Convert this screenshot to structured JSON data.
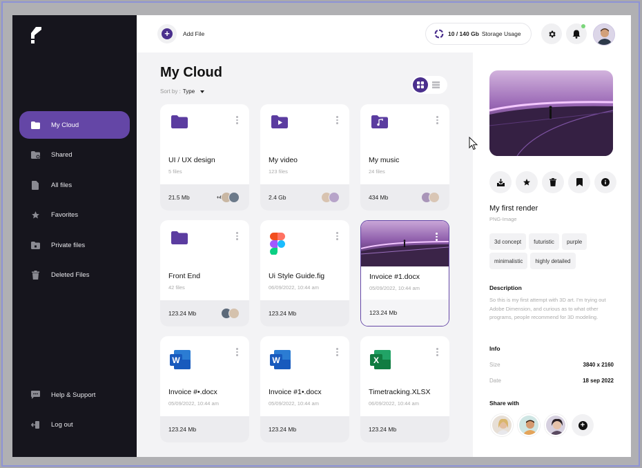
{
  "sidebar": {
    "items": [
      {
        "label": "My Cloud",
        "icon": "folder-icon",
        "active": true
      },
      {
        "label": "Shared",
        "icon": "shared-folder-icon"
      },
      {
        "label": "All files",
        "icon": "file-icon"
      },
      {
        "label": "Favorites",
        "icon": "star-icon"
      },
      {
        "label": "Private files",
        "icon": "lock-folder-icon"
      },
      {
        "label": "Deleted Files",
        "icon": "trash-icon"
      }
    ],
    "bottom": [
      {
        "label": "Help & Support",
        "icon": "chat-icon"
      },
      {
        "label": "Log out",
        "icon": "logout-icon"
      }
    ]
  },
  "topbar": {
    "add_file": "Add File",
    "storage_used": "10 / 140 Gb",
    "storage_label": "Storage Usage"
  },
  "main": {
    "title": "My Cloud",
    "sort_label": "Sort by :",
    "sort_value": "Type"
  },
  "cards": [
    {
      "name": "UI / UX design",
      "sub": "5 files",
      "size": "21.5 Mb",
      "icon": "folder-icon",
      "more": "+4"
    },
    {
      "name": "My video",
      "sub": "123 files",
      "size": "2.4 Gb",
      "icon": "video-folder-icon"
    },
    {
      "name": "My music",
      "sub": "24 files",
      "size": "434 Mb",
      "icon": "music-folder-icon"
    },
    {
      "name": "Front End",
      "sub": "42 files",
      "size": "123.24 Mb",
      "icon": "folder-icon"
    },
    {
      "name": "Ui Style Guide.fig",
      "sub": "06/09/2022, 10:44 am",
      "size": "123.24 Mb",
      "icon": "figma-icon"
    },
    {
      "name": "Invoice #1.docx",
      "sub": "05/09/2022, 10:44 am",
      "size": "123.24 Mb",
      "icon": "image-thumbnail",
      "selected": true
    },
    {
      "name": "Invoice #•.docx",
      "sub": "05/09/2022, 10:44 am",
      "size": "123.24 Mb",
      "icon": "word-icon"
    },
    {
      "name": "Invoice #1•.docx",
      "sub": "05/09/2022, 10:44 am",
      "size": "123.24 Mb",
      "icon": "word-icon"
    },
    {
      "name": "Timetracking.XLSX",
      "sub": "06/09/2022, 10:44 am",
      "size": "123.24 Mb",
      "icon": "excel-icon"
    }
  ],
  "panel": {
    "title": "My first render",
    "type": "PNG-Image",
    "tags": [
      "3d concept",
      "futuristic",
      "purple",
      "minimalistic",
      "highly detailed"
    ],
    "description_heading": "Description",
    "description": "So this is my first attempt with 3D art. I'm trying out Adobe Dimension, and curious as to what other programs, people recommend for 3D modeling.",
    "info_heading": "Info",
    "size_label": "Size",
    "size_value": "3840 x 2160",
    "date_label": "Date",
    "date_value": "18 sep 2022",
    "share_heading": "Share with"
  },
  "colors": {
    "accent": "#6446a6",
    "accent_dark": "#4a2f8d",
    "sidebar_bg": "#16151d"
  }
}
